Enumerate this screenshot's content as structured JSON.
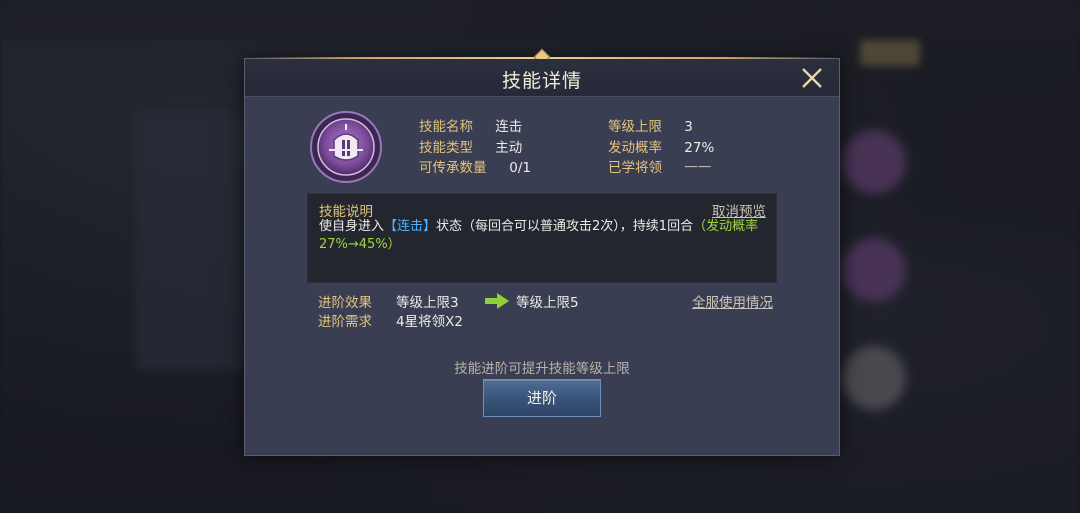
{
  "dialog": {
    "title": "技能详情",
    "skill": {
      "icon": "knight-helmet-icon",
      "name_label": "技能名称",
      "name_value": "连击",
      "type_label": "技能类型",
      "type_value": "主动",
      "inherit_label": "可传承数量",
      "inherit_value": "0/1",
      "level_cap_label": "等级上限",
      "level_cap_value": "3",
      "trigger_label": "发动概率",
      "trigger_value": "27%",
      "learned_label": "已学将领",
      "learned_value": "一一"
    },
    "description": {
      "title": "技能说明",
      "cancel_preview": "取消预览",
      "text_prefix": "使自身进入",
      "text_highlight": "【连击】",
      "text_middle": "状态（每回合可以普通攻击2次），持续1回合",
      "text_green": "（发动概率27%→45%）"
    },
    "advance": {
      "effect_label": "进阶效果",
      "effect_from": "等级上限3",
      "effect_to": "等级上限5",
      "req_label": "进阶需求",
      "req_value": "4星将领X2",
      "usage_link": "全服使用情况"
    },
    "hint": "技能进阶可提升技能等级上限",
    "advance_button": "进阶"
  },
  "colors": {
    "gold_label": "#e2c47c",
    "highlight_blue": "#4fb0ff",
    "highlight_green": "#9fd83a",
    "button_blue": "#385377"
  }
}
